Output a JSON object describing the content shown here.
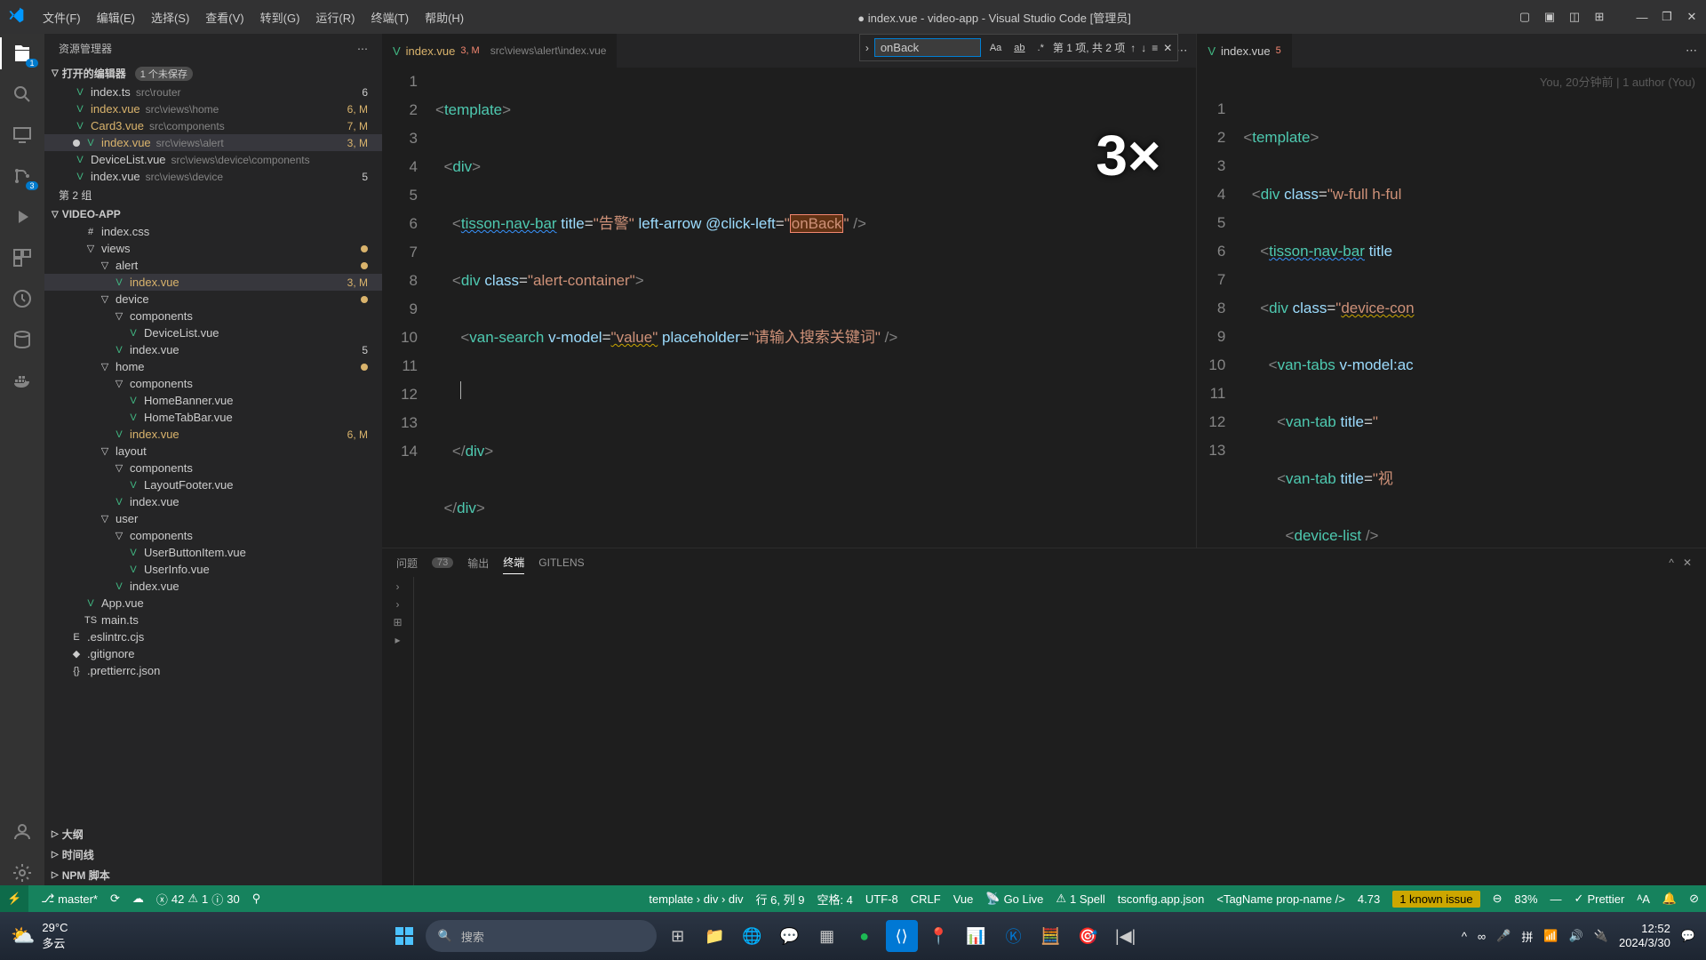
{
  "titlebar": {
    "menus": [
      "文件(F)",
      "编辑(E)",
      "选择(S)",
      "查看(V)",
      "转到(G)",
      "运行(R)",
      "终端(T)",
      "帮助(H)"
    ],
    "title_dot": "●",
    "title": "index.vue - video-app - Visual Studio Code [管理员]"
  },
  "sidebar": {
    "header": "资源管理器",
    "open_editors": {
      "label": "打开的编辑器",
      "badge": "1 个未保存"
    },
    "group2": "第 2 组",
    "project": "VIDEO-APP",
    "sections": {
      "outline": "大纲",
      "timeline": "时间线",
      "npm": "NPM 脚本"
    },
    "open_files": [
      {
        "name": "index.ts",
        "path": "src\\router",
        "status": "6"
      },
      {
        "name": "index.vue",
        "path": "src\\views\\home",
        "status": "6, M",
        "mod": true
      },
      {
        "name": "Card3.vue",
        "path": "src\\components",
        "status": "7, M",
        "mod": true
      },
      {
        "name": "index.vue",
        "path": "src\\views\\alert",
        "status": "3, M",
        "mod": true,
        "unsaved": true,
        "selected": true
      },
      {
        "name": "DeviceList.vue",
        "path": "src\\views\\device\\components"
      },
      {
        "name": "index.vue",
        "path": "src\\views\\device",
        "status": "5"
      }
    ],
    "tree": [
      {
        "depth": 1,
        "name": "index.css",
        "icon": "#"
      },
      {
        "depth": 1,
        "name": "views",
        "folder": true,
        "dot": true
      },
      {
        "depth": 2,
        "name": "alert",
        "folder": true,
        "dot": true
      },
      {
        "depth": 3,
        "name": "index.vue",
        "mod": true,
        "status": "3, M",
        "selected": true,
        "icon": "V"
      },
      {
        "depth": 2,
        "name": "device",
        "folder": true,
        "dot": true
      },
      {
        "depth": 3,
        "name": "components",
        "folder": true
      },
      {
        "depth": 4,
        "name": "DeviceList.vue",
        "icon": "V"
      },
      {
        "depth": 3,
        "name": "index.vue",
        "status": "5",
        "icon": "V"
      },
      {
        "depth": 2,
        "name": "home",
        "folder": true,
        "dot": true
      },
      {
        "depth": 3,
        "name": "components",
        "folder": true
      },
      {
        "depth": 4,
        "name": "HomeBanner.vue",
        "icon": "V"
      },
      {
        "depth": 4,
        "name": "HomeTabBar.vue",
        "icon": "V"
      },
      {
        "depth": 3,
        "name": "index.vue",
        "mod": true,
        "status": "6, M",
        "icon": "V"
      },
      {
        "depth": 2,
        "name": "layout",
        "folder": true
      },
      {
        "depth": 3,
        "name": "components",
        "folder": true
      },
      {
        "depth": 4,
        "name": "LayoutFooter.vue",
        "icon": "V"
      },
      {
        "depth": 3,
        "name": "index.vue",
        "icon": "V"
      },
      {
        "depth": 2,
        "name": "user",
        "folder": true
      },
      {
        "depth": 3,
        "name": "components",
        "folder": true
      },
      {
        "depth": 4,
        "name": "UserButtonItem.vue",
        "icon": "V"
      },
      {
        "depth": 4,
        "name": "UserInfo.vue",
        "icon": "V"
      },
      {
        "depth": 3,
        "name": "index.vue",
        "icon": "V"
      },
      {
        "depth": 1,
        "name": "App.vue",
        "icon": "V"
      },
      {
        "depth": 1,
        "name": "main.ts",
        "icon": "TS"
      },
      {
        "depth": 0,
        "name": ".eslintrc.cjs",
        "icon": "E"
      },
      {
        "depth": 0,
        "name": ".gitignore",
        "icon": "◆"
      },
      {
        "depth": 0,
        "name": ".prettierrc.json",
        "icon": "{}"
      }
    ]
  },
  "editor_left": {
    "tab_name": "index.vue",
    "tab_err": "3, M",
    "breadcrumb": "src\\views\\alert\\index.vue",
    "find": {
      "value": "onBack",
      "count": "第 1 项, 共 2 项"
    },
    "zoom": "3×",
    "lines": [
      1,
      2,
      3,
      4,
      5,
      6,
      7,
      8,
      9,
      10,
      11,
      12,
      13,
      14
    ]
  },
  "editor_right": {
    "tab_name": "index.vue",
    "tab_err": "5",
    "blame": "You, 20分钟前 | 1 author (You)",
    "lines": [
      1,
      2,
      3,
      4,
      5,
      6,
      7,
      8,
      9,
      10,
      11,
      12,
      13
    ]
  },
  "panel": {
    "tabs": {
      "problems": "问题",
      "problems_count": "73",
      "output": "输出",
      "terminal": "终端",
      "gitlens": "GITLENS"
    }
  },
  "status": {
    "branch": "master*",
    "errors": "42",
    "warnings": "1",
    "info": "30",
    "position_crumb": "template › div › div",
    "cursor": "行 6, 列 9",
    "spaces": "空格: 4",
    "encoding": "UTF-8",
    "eol": "CRLF",
    "lang": "Vue",
    "golive": "Go Live",
    "spell": "1 Spell",
    "tsconfig": "tsconfig.app.json",
    "tagname": "<TagName prop-name />",
    "version": "4.73",
    "issue": "1 known issue",
    "zoom": "83%",
    "prettier": "Prettier"
  },
  "taskbar": {
    "temp": "29°C",
    "weather": "多云",
    "search": "搜索",
    "time": "12:52",
    "date": "2024/3/30"
  },
  "activity_badges": {
    "explorer": "1",
    "scm": "3"
  }
}
